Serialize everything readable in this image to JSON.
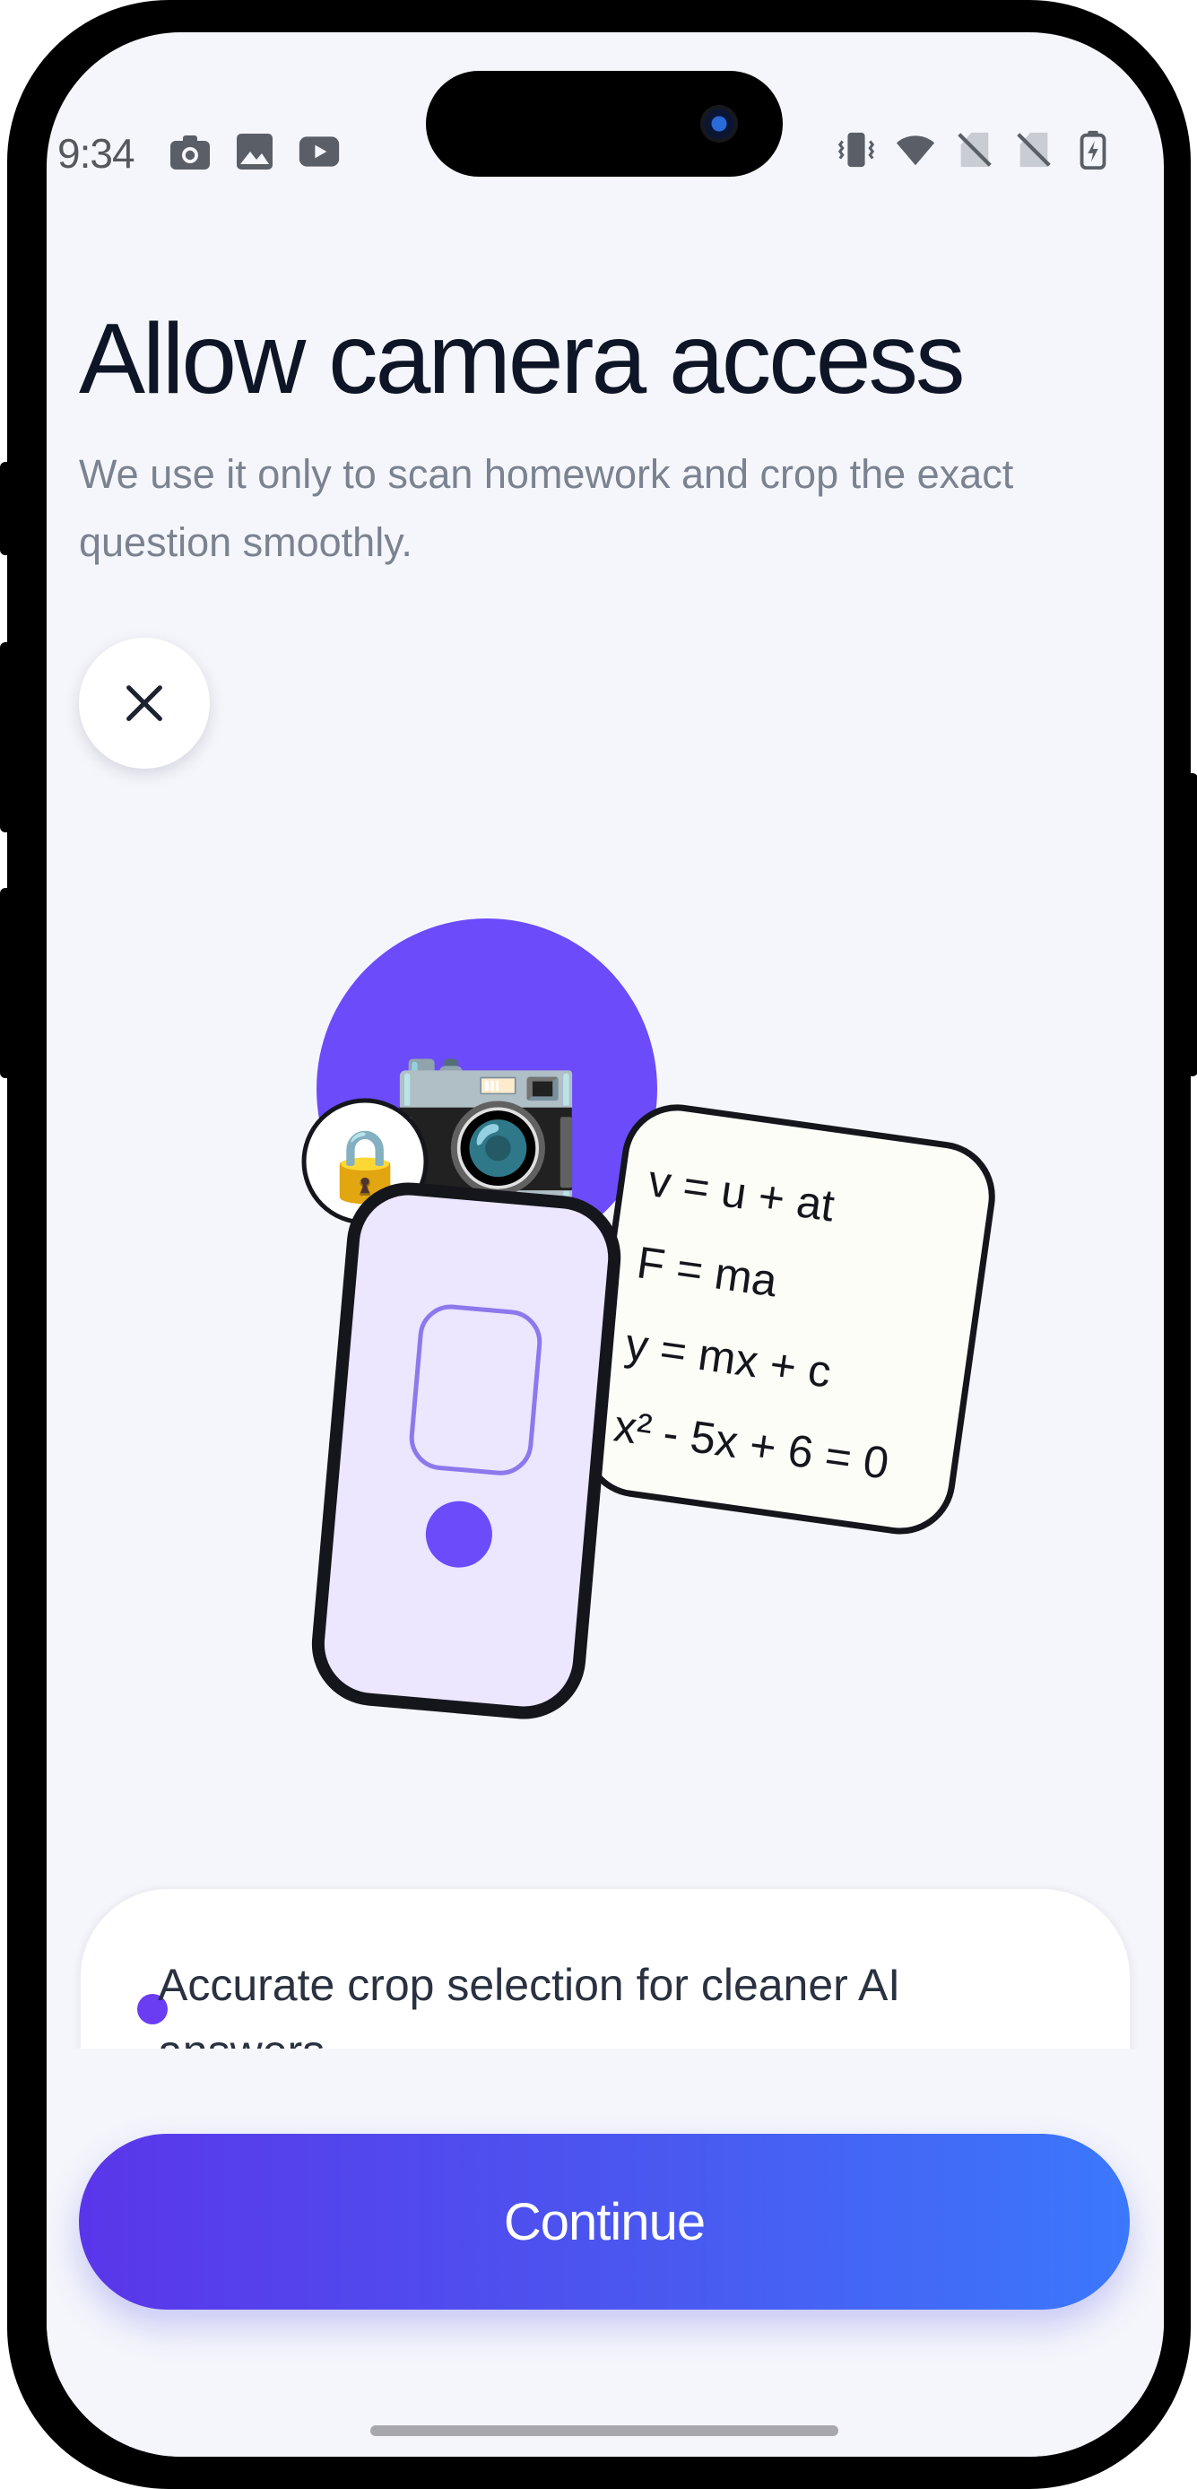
{
  "status_bar": {
    "time": "9:34",
    "left_icons": [
      "camera-icon",
      "image-icon",
      "youtube-icon"
    ],
    "right_icons": [
      "vibrate-icon",
      "wifi-icon",
      "no-sim-icon",
      "no-sim-icon",
      "battery-charging-icon"
    ]
  },
  "header": {
    "title": "Allow camera access",
    "subtitle": "We use it only to scan homework and crop the exact question smoothly."
  },
  "close_button": {
    "icon": "close-icon"
  },
  "illustration": {
    "camera_emoji": "📷",
    "lock_emoji": "🔒",
    "formulas": [
      "v = u + at",
      "F = ma",
      "y = mx + c",
      "x² - 5x + 6 = 0"
    ]
  },
  "features": [
    "Accurate crop selection for cleaner AI answers"
  ],
  "continue_button": {
    "label": "Continue"
  },
  "colors": {
    "accent": "#6b4bfa",
    "button_gradient_start": "#5a36ea",
    "button_gradient_end": "#3b78fc",
    "background": "#f5f6fb",
    "title": "#0e1526"
  }
}
